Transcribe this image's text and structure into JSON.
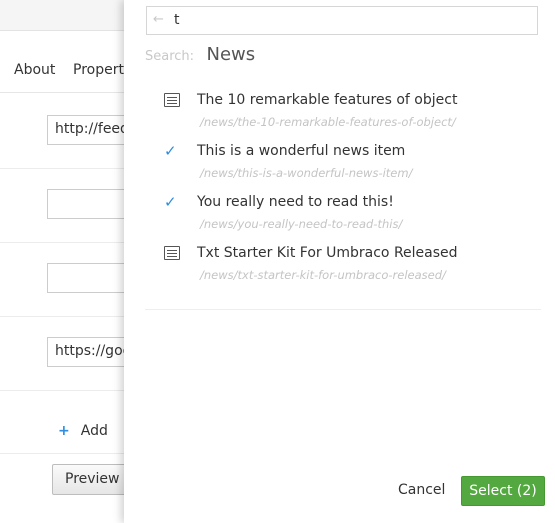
{
  "background": {
    "tabs": [
      {
        "label": "About"
      },
      {
        "label": "Properti"
      }
    ],
    "inputs": [
      {
        "value": "http://feed"
      },
      {
        "value": ""
      },
      {
        "value": ""
      },
      {
        "value": "https://goo"
      }
    ],
    "add_label": "Add",
    "preview_label": "Preview"
  },
  "panel": {
    "search": {
      "value": "t",
      "back_icon": "arrow-left-icon"
    },
    "crumb": {
      "label": "Search:",
      "node": "News"
    },
    "results": [
      {
        "title": "The 10 remarkable features of object",
        "path": "/news/the-10-remarkable-features-of-object/",
        "icon": "document-icon",
        "selected": false
      },
      {
        "title": "This is a wonderful news item",
        "path": "/news/this-is-a-wonderful-news-item/",
        "icon": "check-icon",
        "selected": true
      },
      {
        "title": "You really need to read this!",
        "path": "/news/you-really-need-to-read-this/",
        "icon": "check-icon",
        "selected": true
      },
      {
        "title": "Txt Starter Kit For Umbraco Released",
        "path": "/news/txt-starter-kit-for-umbraco-released/",
        "icon": "document-icon",
        "selected": false
      }
    ],
    "cancel_label": "Cancel",
    "select_label": "Select (2)",
    "colors": {
      "accent": "#2e8ee0",
      "select_button": "#53a93f"
    }
  }
}
